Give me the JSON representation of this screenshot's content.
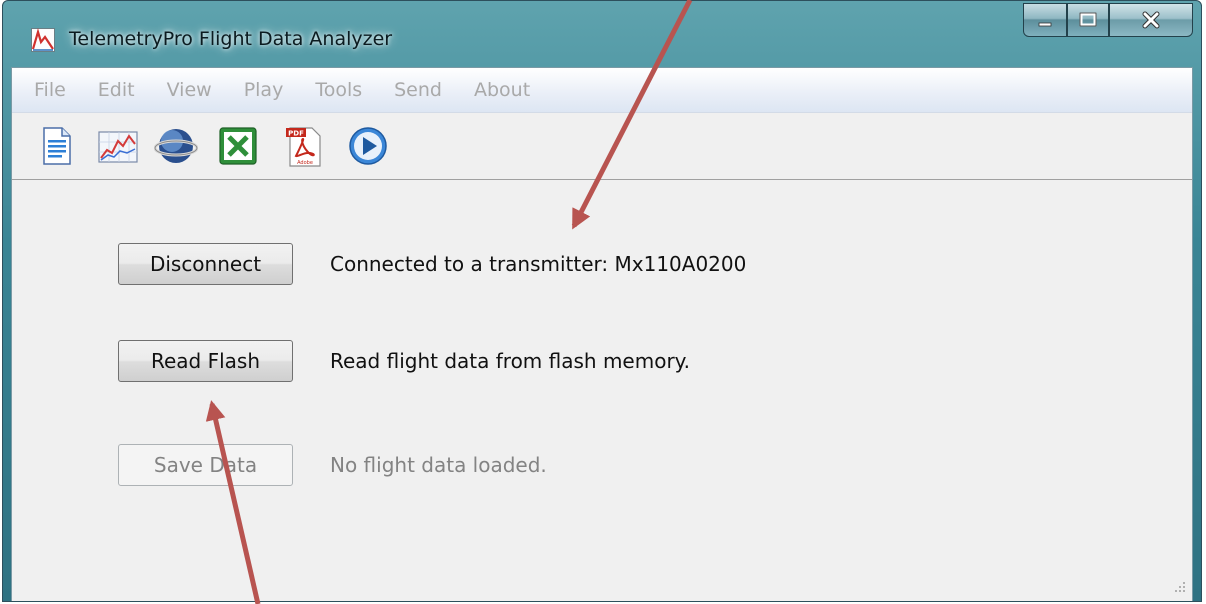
{
  "window": {
    "title": "TelemetryPro Flight Data Analyzer"
  },
  "menu": [
    "File",
    "Edit",
    "View",
    "Play",
    "Tools",
    "Send",
    "About"
  ],
  "toolbar": {
    "icons": [
      "document-icon",
      "chart-icon",
      "globe-icon",
      "excel-icon",
      "pdf-icon",
      "play-icon"
    ],
    "pdf_badge": "PDF",
    "adobe_text": "Adobe"
  },
  "actions": {
    "disconnect": {
      "label": "Disconnect",
      "status": "Connected to a transmitter: Mx110A0200",
      "enabled": true
    },
    "read_flash": {
      "label": "Read Flash",
      "status": "Read flight data from flash memory.",
      "enabled": true
    },
    "save_data": {
      "label": "Save Data",
      "status": "No flight data loaded.",
      "enabled": false
    }
  },
  "colors": {
    "annotation_arrow": "#b85450"
  }
}
